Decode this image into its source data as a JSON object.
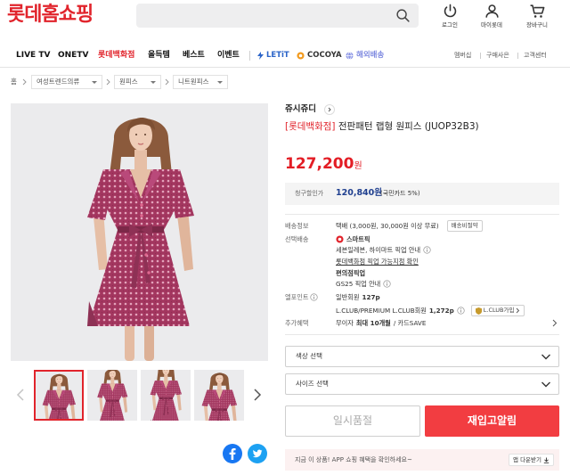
{
  "header": {
    "logo": "롯데홈쇼핑",
    "search_icon": "search-icon",
    "icons": [
      {
        "label": "로그인",
        "icon": "power-icon"
      },
      {
        "label": "마이롯데",
        "icon": "person-icon"
      },
      {
        "label": "장바구니",
        "icon": "cart-icon"
      }
    ]
  },
  "nav": {
    "items": [
      "LIVE TV",
      "ONETV",
      "롯데백화점",
      "올득템",
      "베스트",
      "이벤트"
    ],
    "brands": [
      "LETiT",
      "COCOYA",
      "해외배송"
    ],
    "utility": [
      "멤버십",
      "구매사은",
      "고객센터"
    ]
  },
  "breadcrumb": {
    "home": "홈",
    "levels": [
      "여성트렌드의류",
      "원피스",
      "니트원피스"
    ]
  },
  "product": {
    "brand": "쥬시쥬디",
    "title_prefix": "[롯데백화점]",
    "title": "전판패턴 랩형 원피스 (JUOP32B3)",
    "price": "127,200",
    "price_unit": "원",
    "billing_discount": {
      "label": "청구할인가",
      "price": "120,840원",
      "note": "(국민카드 5%)"
    },
    "shipping": {
      "label": "배송정보",
      "text": "택배 (3,000원, 30,000원 이상 무료)",
      "button": "배송비절약"
    },
    "pickup": {
      "label": "선택배송",
      "smartpick": "스마트픽",
      "seven_hi": "세븐일레븐, 하이마트 픽업 안내",
      "lotte_dept": "롯데백화점 픽업 가능지점 확인",
      "cvs_title": "편의점픽업",
      "gs25": "GS25 픽업 안내"
    },
    "lpoint": {
      "label": "엘포인트",
      "general_label": "일반회원",
      "general_points": "127p",
      "lclub_label": "L.CLUB/PREMIUM L.CLUB회원",
      "lclub_points": "1,272p",
      "join_button": "L.CLUB가입"
    },
    "benefits": {
      "label": "추가혜택",
      "prefix": "무이자",
      "highlight": "최대 10개월",
      "suffix": "/ 카드SAVE"
    }
  },
  "options": {
    "color_select": "색상 선택",
    "size_select": "사이즈 선택"
  },
  "actions": {
    "soldout": "일시품절",
    "restock_alert": "재입고알림"
  },
  "app_banner": {
    "text": "지금 이 상품! APP 쇼핑 혜택을 확인하세요~",
    "button": "앱 다운받기"
  },
  "share": {
    "icons": [
      "facebook-icon",
      "twitter-icon"
    ]
  },
  "colors": {
    "brand_red": "#e1242c",
    "price_red": "#e31d25",
    "discount_navy": "#1f3f8f",
    "button_red": "#f23d41",
    "facebook": "#1877f2",
    "twitter": "#1da1f2"
  }
}
